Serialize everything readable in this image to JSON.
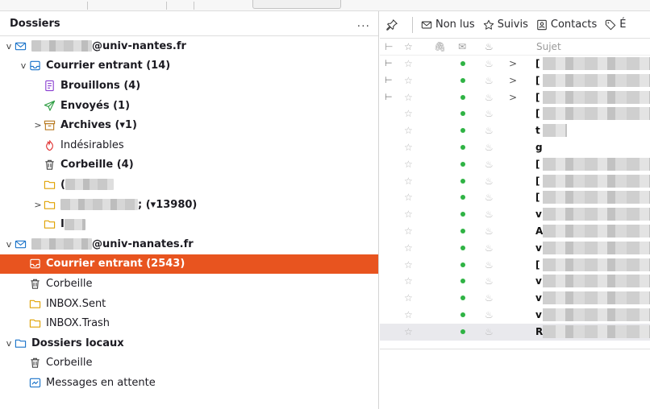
{
  "folder_pane": {
    "title": "Dossiers",
    "menu_label": "...",
    "rows": [
      {
        "level": 0,
        "twisty": "v",
        "icon": "account-mail-icon",
        "prefix": "",
        "label": "@univ-nantes.fr",
        "bold": true,
        "blur_before": 75,
        "blur_after": 0
      },
      {
        "level": 1,
        "twisty": "v",
        "icon": "inbox-icon",
        "prefix": "",
        "label": "Courrier entrant (14)",
        "bold": true,
        "blur_before": 0,
        "blur_after": 0
      },
      {
        "level": 2,
        "twisty": "",
        "icon": "drafts-icon",
        "prefix": "",
        "label": "Brouillons (4)",
        "bold": true,
        "blur_before": 0,
        "blur_after": 0
      },
      {
        "level": 2,
        "twisty": "",
        "icon": "sent-icon",
        "prefix": "",
        "label": "Envoyés (1)",
        "bold": true,
        "blur_before": 0,
        "blur_after": 0
      },
      {
        "level": 2,
        "twisty": ">",
        "icon": "archive-icon",
        "prefix": "",
        "label": "Archives (▾1)",
        "bold": true,
        "blur_before": 0,
        "blur_after": 0
      },
      {
        "level": 2,
        "twisty": "",
        "icon": "junk-icon",
        "prefix": "",
        "label": "Indésirables",
        "bold": false,
        "blur_before": 0,
        "blur_after": 0
      },
      {
        "level": 2,
        "twisty": "",
        "icon": "trash-icon",
        "prefix": "",
        "label": "Corbeille (4)",
        "bold": true,
        "blur_before": 0,
        "blur_after": 0
      },
      {
        "level": 2,
        "twisty": "",
        "icon": "folder-icon",
        "prefix": "(",
        "label": "",
        "bold": true,
        "blur_before": 0,
        "blur_after": 60
      },
      {
        "level": 2,
        "twisty": ">",
        "icon": "folder-icon",
        "prefix": "",
        "label": "; (▾13980)",
        "bold": true,
        "blur_before": 96,
        "blur_after": 0
      },
      {
        "level": 2,
        "twisty": "",
        "icon": "folder-icon",
        "prefix": "I",
        "label": "",
        "bold": true,
        "blur_before": 0,
        "blur_after": 26
      },
      {
        "level": 0,
        "twisty": "v",
        "icon": "account-mail-icon",
        "prefix": "",
        "label": "@univ-nanates.fr",
        "bold": true,
        "blur_before": 75,
        "blur_after": 0
      },
      {
        "level": 1,
        "twisty": "",
        "icon": "inbox-icon",
        "prefix": "",
        "label": "Courrier entrant (2543)",
        "bold": true,
        "selected": true,
        "blur_before": 0,
        "blur_after": 0
      },
      {
        "level": 1,
        "twisty": "",
        "icon": "trash-icon",
        "prefix": "",
        "label": "Corbeille",
        "bold": false,
        "blur_before": 0,
        "blur_after": 0
      },
      {
        "level": 1,
        "twisty": "",
        "icon": "folder-icon",
        "prefix": "",
        "label": "INBOX.Sent",
        "bold": false,
        "blur_before": 0,
        "blur_after": 0
      },
      {
        "level": 1,
        "twisty": "",
        "icon": "folder-icon",
        "prefix": "",
        "label": "INBOX.Trash",
        "bold": false,
        "blur_before": 0,
        "blur_after": 0
      },
      {
        "level": 0,
        "twisty": "v",
        "icon": "local-folders-icon",
        "prefix": "",
        "label": "Dossiers locaux",
        "bold": true,
        "blur_before": 0,
        "blur_after": 0
      },
      {
        "level": 1,
        "twisty": "",
        "icon": "trash-icon",
        "prefix": "",
        "label": "Corbeille",
        "bold": false,
        "blur_before": 0,
        "blur_after": 0
      },
      {
        "level": 1,
        "twisty": "",
        "icon": "outbox-icon",
        "prefix": "",
        "label": "Messages en attente",
        "bold": false,
        "blur_before": 0,
        "blur_after": 0
      }
    ]
  },
  "quick_filter": {
    "pin_icon": "pin-icon",
    "buttons": [
      {
        "icon": "unread-icon",
        "label": "Non lus"
      },
      {
        "icon": "star-icon",
        "label": "Suivis"
      },
      {
        "icon": "contact-icon",
        "label": "Contacts"
      },
      {
        "icon": "tag-icon",
        "label": "É"
      }
    ]
  },
  "message_list": {
    "column_subject": "Sujet",
    "rows": [
      {
        "thread": "⊢",
        "chevron": ">",
        "subject_start": "["
      },
      {
        "thread": "⊢",
        "chevron": ">",
        "subject_start": "["
      },
      {
        "thread": "⊢",
        "chevron": ">",
        "subject_start": "["
      },
      {
        "thread": "",
        "chevron": "",
        "subject_start": "["
      },
      {
        "thread": "",
        "chevron": "",
        "subject_start": "t"
      },
      {
        "thread": "",
        "chevron": "",
        "subject_start": "g"
      },
      {
        "thread": "",
        "chevron": "",
        "subject_start": "["
      },
      {
        "thread": "",
        "chevron": "",
        "subject_start": "["
      },
      {
        "thread": "",
        "chevron": "",
        "subject_start": "["
      },
      {
        "thread": "",
        "chevron": "",
        "subject_start": "v"
      },
      {
        "thread": "",
        "chevron": "",
        "subject_start": "A"
      },
      {
        "thread": "",
        "chevron": "",
        "subject_start": "v"
      },
      {
        "thread": "",
        "chevron": "",
        "subject_start": "["
      },
      {
        "thread": "",
        "chevron": "",
        "subject_start": "v"
      },
      {
        "thread": "",
        "chevron": "",
        "subject_start": "v"
      },
      {
        "thread": "",
        "chevron": "",
        "subject_start": "v"
      },
      {
        "thread": "",
        "chevron": "",
        "subject_start": "R",
        "highlighted": true
      }
    ]
  },
  "colors": {
    "selection": "#e8541f",
    "unread_dot": "#2fb344",
    "accent_icon": "#1a73c9"
  }
}
